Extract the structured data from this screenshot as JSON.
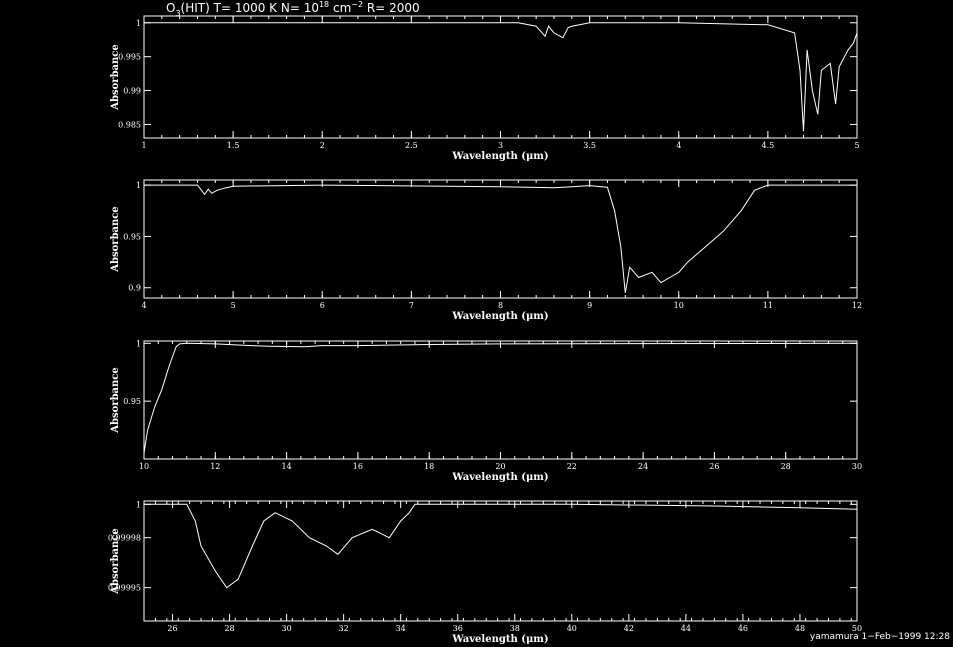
{
  "title": {
    "prefix": "O",
    "sub": "3",
    "part1": "(HIT) T= 1000 K N= 10",
    "sup1": "18",
    "part2": " cm",
    "sup2": "−2",
    "part3": " R= 2000"
  },
  "footer": "yamamura  1−Feb−1999 12:28",
  "chart_data": [
    {
      "type": "line",
      "xlabel": "Wavelength (μm)",
      "ylabel": "Absorbance",
      "xlim": [
        1,
        5
      ],
      "ylim": [
        0.983,
        1.001
      ],
      "xticks": [
        1,
        1.5,
        2,
        2.5,
        3,
        3.5,
        4,
        4.5,
        5
      ],
      "xticklabels": [
        "1",
        "1.5",
        "2",
        "2.5",
        "3",
        "3.5",
        "4",
        "4.5",
        "5"
      ],
      "yticks": [
        0.985,
        0.99,
        0.995,
        1
      ],
      "yticklabels": [
        "0.985",
        "0.99",
        "0.995",
        "1"
      ],
      "x": [
        1.0,
        3.1,
        3.2,
        3.25,
        3.27,
        3.3,
        3.35,
        3.38,
        3.4,
        3.5,
        4.0,
        4.5,
        4.65,
        4.68,
        4.7,
        4.72,
        4.75,
        4.78,
        4.8,
        4.85,
        4.88,
        4.9,
        4.95,
        4.98,
        5.0
      ],
      "y": [
        1.0,
        1.0,
        0.9995,
        0.998,
        0.9995,
        0.9985,
        0.9978,
        0.9993,
        0.9995,
        1.0,
        1.0,
        0.9997,
        0.9985,
        0.993,
        0.984,
        0.996,
        0.99,
        0.9865,
        0.993,
        0.994,
        0.988,
        0.9935,
        0.996,
        0.997,
        0.9985
      ]
    },
    {
      "type": "line",
      "xlabel": "Wavelength (μm)",
      "ylabel": "Absorbance",
      "xlim": [
        4,
        12
      ],
      "ylim": [
        0.89,
        1.005
      ],
      "xticks": [
        4,
        5,
        6,
        7,
        8,
        9,
        10,
        11,
        12
      ],
      "xticklabels": [
        "4",
        "5",
        "6",
        "7",
        "8",
        "9",
        "10",
        "11",
        "12"
      ],
      "yticks": [
        0.9,
        0.95,
        1
      ],
      "yticklabels": [
        "0.9",
        "0.95",
        "1"
      ],
      "x": [
        4.0,
        4.6,
        4.68,
        4.72,
        4.76,
        4.82,
        4.9,
        5.0,
        6.0,
        8.0,
        8.6,
        8.8,
        9.0,
        9.2,
        9.28,
        9.35,
        9.4,
        9.45,
        9.55,
        9.7,
        9.8,
        9.9,
        10.0,
        10.1,
        10.3,
        10.5,
        10.7,
        10.85,
        11.0,
        12.0
      ],
      "y": [
        1.0,
        1.0,
        0.991,
        0.996,
        0.992,
        0.995,
        0.997,
        0.999,
        1.0,
        0.9985,
        0.9975,
        0.9985,
        0.9995,
        0.998,
        0.975,
        0.94,
        0.895,
        0.92,
        0.91,
        0.915,
        0.905,
        0.91,
        0.915,
        0.925,
        0.94,
        0.955,
        0.975,
        0.995,
        1.0,
        1.0
      ]
    },
    {
      "type": "line",
      "xlabel": "Wavelength (μm)",
      "ylabel": "Absorbance",
      "xlim": [
        10,
        30
      ],
      "ylim": [
        0.9,
        1.002
      ],
      "xticks": [
        10,
        12,
        14,
        16,
        18,
        20,
        22,
        24,
        26,
        28,
        30
      ],
      "xticklabels": [
        "10",
        "12",
        "14",
        "16",
        "18",
        "20",
        "22",
        "24",
        "26",
        "28",
        "30"
      ],
      "yticks": [
        0.95,
        1
      ],
      "yticklabels": [
        "0.95",
        "1"
      ],
      "x": [
        10.0,
        10.1,
        10.3,
        10.5,
        10.7,
        10.9,
        11.0,
        11.2,
        12.0,
        13.0,
        13.5,
        14.5,
        15.0,
        16.0,
        18.0,
        20.0,
        30.0
      ],
      "y": [
        0.905,
        0.925,
        0.945,
        0.96,
        0.98,
        0.997,
        0.9995,
        1.0,
        0.9995,
        0.998,
        0.9975,
        0.997,
        0.998,
        0.998,
        0.999,
        0.9995,
        1.0
      ]
    },
    {
      "type": "line",
      "xlabel": "Wavelength (μm)",
      "ylabel": "Absorbance",
      "xlim": [
        25,
        50
      ],
      "ylim": [
        0.99993,
        1.000002
      ],
      "xticks": [
        26,
        28,
        30,
        32,
        34,
        36,
        38,
        40,
        42,
        44,
        46,
        48,
        50
      ],
      "xticklabels": [
        "26",
        "28",
        "30",
        "32",
        "34",
        "36",
        "38",
        "40",
        "42",
        "44",
        "46",
        "48",
        "50"
      ],
      "yticks": [
        0.99995,
        0.99998,
        1
      ],
      "yticklabels": [
        "0.99995",
        "0.99998",
        "1"
      ],
      "x": [
        25.0,
        26.5,
        26.8,
        27.0,
        27.5,
        27.9,
        28.3,
        28.8,
        29.2,
        29.6,
        30.2,
        30.8,
        31.4,
        31.8,
        32.3,
        33.0,
        33.6,
        34.0,
        34.3,
        34.5,
        40.0,
        45.0,
        48.0,
        50.0
      ],
      "y": [
        1.0,
        1.0,
        0.99999,
        0.999975,
        0.99996,
        0.99995,
        0.999955,
        0.999975,
        0.99999,
        0.999995,
        0.99999,
        0.99998,
        0.999975,
        0.99997,
        0.99998,
        0.999985,
        0.99998,
        0.99999,
        0.999995,
        1.0,
        1.0,
        0.999999,
        0.999998,
        0.999997
      ]
    }
  ]
}
